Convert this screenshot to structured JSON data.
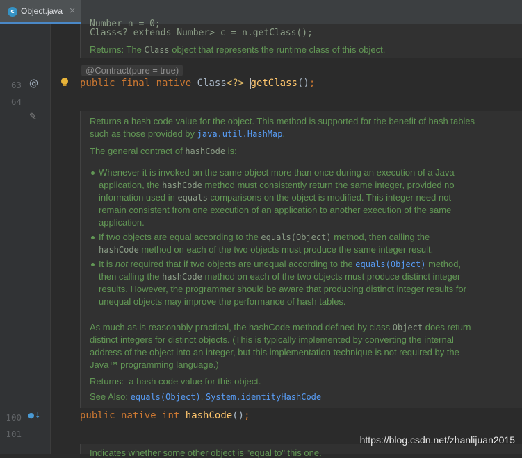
{
  "tab": {
    "icon": "c",
    "label": "Object.java",
    "close": "×"
  },
  "gutter": {
    "line_63": "63",
    "line_64": "64",
    "line_100": "100",
    "line_101": "101",
    "annotation_marker": "@",
    "edit_marker": "✎",
    "override_marker": "●↓"
  },
  "doc_top": {
    "code_partial": "Number n = 0;",
    "code_line": "Class<? extends Number> c = n.getClass();",
    "returns_prefix": "Returns: The ",
    "returns_code": "Class",
    "returns_suffix": " object that represents the runtime class of this object."
  },
  "annotation": "@Contract(pure = true)",
  "code": {
    "line63": {
      "kw1": "public",
      "kw2": "final",
      "kw3": "native",
      "type": "Class",
      "generic": "<?>",
      "name": "getClass",
      "parens": "()",
      "semi": ";"
    },
    "line100": {
      "kw1": "public",
      "kw2": "native",
      "type": "int",
      "name": "hashCode",
      "parens": "()",
      "semi": ";"
    }
  },
  "doc_main": {
    "p1_line1": "Returns a hash code value for the object. This method is supported for the benefit of hash tables",
    "p1_line2_prefix": "such as those provided by ",
    "p1_line2_link": "java.util.HashMap",
    "p1_line2_suffix": ".",
    "p2_prefix": "The general contract of ",
    "p2_code": "hashCode",
    "p2_suffix": " is:",
    "b1": {
      "l1": "Whenever it is invoked on the same object more than once during an execution of a Java",
      "l2_a": "application, the ",
      "l2_code": "hashCode",
      "l2_b": " method must consistently return the same integer, provided no",
      "l3_a": "information used in ",
      "l3_code": "equals",
      "l3_b": " comparisons on the object is modified. This integer need not",
      "l4": "remain consistent from one execution of an application to another execution of the same",
      "l5": "application."
    },
    "b2": {
      "l1_a": "If two objects are equal according to the ",
      "l1_code": "equals(Object)",
      "l1_b": " method, then calling the",
      "l2_code": "hashCode",
      "l2_b": " method on each of the two objects must produce the same integer result."
    },
    "b3": {
      "l1_a": "It is ",
      "l1_em": "not",
      "l1_b": " required that if two objects are unequal according to the ",
      "l1_link": "equals(Object)",
      "l1_c": " method,",
      "l2_a": "then calling the ",
      "l2_code": "hashCode",
      "l2_b": " method on each of the two objects must produce distinct integer",
      "l3": "results. However, the programmer should be aware that producing distinct integer results for",
      "l4": "unequal objects may improve the performance of hash tables."
    },
    "p3_l1_a": "As much as is reasonably practical, the hashCode method defined by class ",
    "p3_l1_code": "Object",
    "p3_l1_b": " does return",
    "p3_l2": "distinct integers for distinct objects. (This is typically implemented by converting the internal",
    "p3_l3": "address of the object into an integer, but this implementation technique is not required by the",
    "p3_l4": "Java™ programming language.)",
    "returns_label": "Returns:",
    "returns_text": "a hash code value for this object.",
    "seealso_label": "See Also:",
    "seealso_link1": "equals(Object)",
    "seealso_sep": ",",
    "seealso_link2": "System.identityHashCode"
  },
  "doc_bottom_partial": "Indicates whether some other object is \"equal to\" this one.",
  "watermark": "https://blog.csdn.net/zhanlijuan2015"
}
